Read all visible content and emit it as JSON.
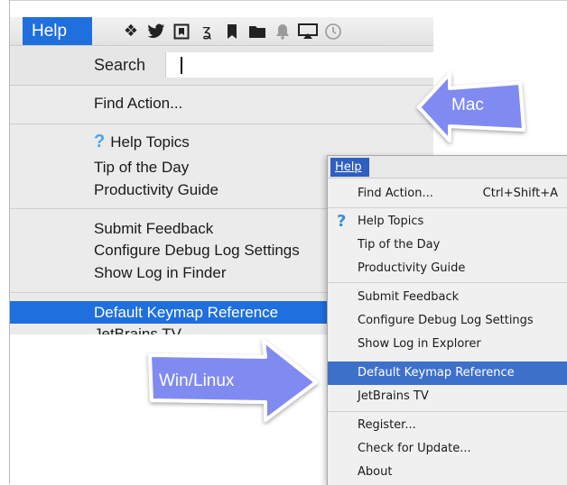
{
  "mac_menu": {
    "menu_title": "Help",
    "search_label": "Search",
    "items": {
      "find_action": "Find Action...",
      "help_topics": "Help Topics",
      "tip_of_day": "Tip of the Day",
      "productivity_guide": "Productivity Guide",
      "submit_feedback": "Submit Feedback",
      "configure_debug": "Configure Debug Log Settings",
      "show_log": "Show Log in Finder",
      "default_keymap": "Default Keymap Reference",
      "jetbrains_tv": "JetBrains TV"
    },
    "menubar_icons": [
      "dropbox-icon",
      "twitter-icon",
      "evernote-icon",
      "klokki-icon",
      "bookmark-icon",
      "folder-icon",
      "bell-icon",
      "airplay-icon",
      "time-machine-icon"
    ]
  },
  "win_menu": {
    "menu_title": "Help",
    "items": {
      "find_action": "Find Action...",
      "find_action_shortcut": "Ctrl+Shift+A",
      "help_topics": "Help Topics",
      "tip_of_day": "Tip of the Day",
      "productivity_guide": "Productivity Guide",
      "submit_feedback": "Submit Feedback",
      "configure_debug": "Configure Debug Log Settings",
      "show_log": "Show Log in Explorer",
      "default_keymap": "Default Keymap Reference",
      "jetbrains_tv": "JetBrains TV",
      "register": "Register...",
      "check_update": "Check for Update...",
      "about": "About"
    }
  },
  "callouts": {
    "mac": "Mac",
    "win_linux": "Win/Linux"
  },
  "colors": {
    "mac_selection": "#1f6fde",
    "win_selection": "#3d70c9",
    "callout_fill": "#7f8bf0"
  }
}
